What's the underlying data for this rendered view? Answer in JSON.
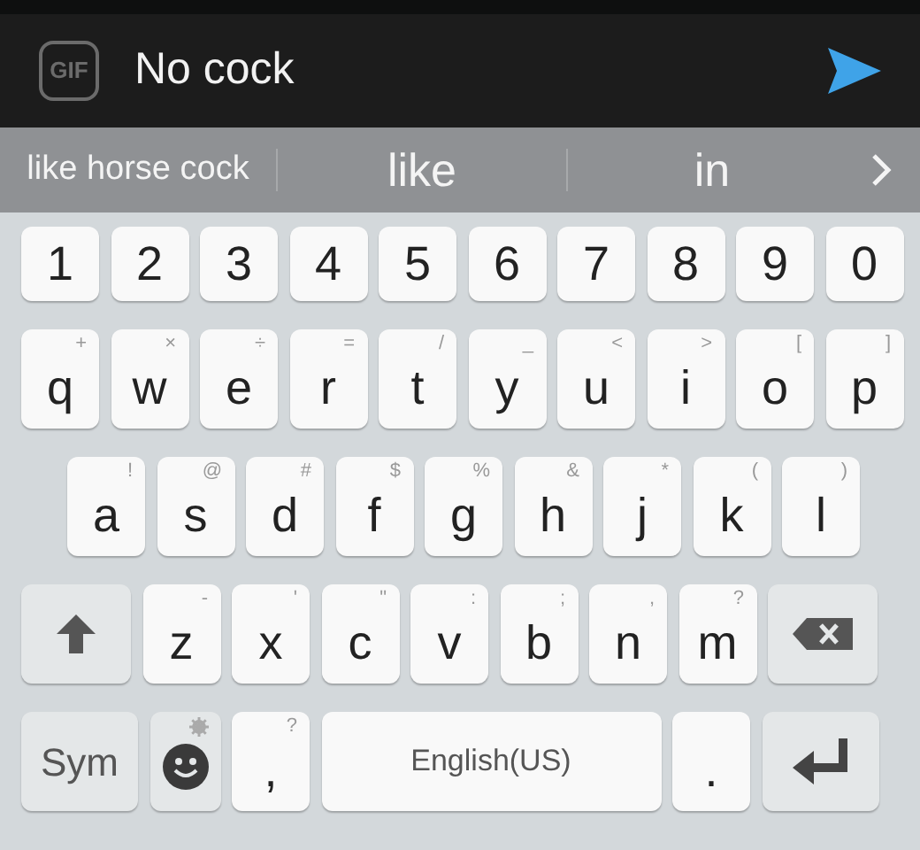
{
  "message_bar": {
    "gif_label": "GIF",
    "text": "No cock"
  },
  "suggestions": [
    {
      "text": "like horse cock",
      "kind": "phrase"
    },
    {
      "text": "like",
      "kind": "word"
    },
    {
      "text": "in",
      "kind": "word"
    }
  ],
  "keyboard": {
    "rows": [
      {
        "keys": [
          {
            "kind": "char",
            "label": "1"
          },
          {
            "kind": "char",
            "label": "2"
          },
          {
            "kind": "char",
            "label": "3"
          },
          {
            "kind": "char",
            "label": "4"
          },
          {
            "kind": "char",
            "label": "5"
          },
          {
            "kind": "char",
            "label": "6"
          },
          {
            "kind": "char",
            "label": "7"
          },
          {
            "kind": "char",
            "label": "8"
          },
          {
            "kind": "char",
            "label": "9"
          },
          {
            "kind": "char",
            "label": "0"
          }
        ]
      },
      {
        "keys": [
          {
            "kind": "char",
            "label": "q",
            "hint": "+"
          },
          {
            "kind": "char",
            "label": "w",
            "hint": "×"
          },
          {
            "kind": "char",
            "label": "e",
            "hint": "÷"
          },
          {
            "kind": "char",
            "label": "r",
            "hint": "="
          },
          {
            "kind": "char",
            "label": "t",
            "hint": "/"
          },
          {
            "kind": "char",
            "label": "y",
            "hint": "_"
          },
          {
            "kind": "char",
            "label": "u",
            "hint": "<"
          },
          {
            "kind": "char",
            "label": "i",
            "hint": ">"
          },
          {
            "kind": "char",
            "label": "o",
            "hint": "["
          },
          {
            "kind": "char",
            "label": "p",
            "hint": "]"
          }
        ]
      },
      {
        "keys": [
          {
            "kind": "char",
            "label": "a",
            "hint": "!"
          },
          {
            "kind": "char",
            "label": "s",
            "hint": "@"
          },
          {
            "kind": "char",
            "label": "d",
            "hint": "#"
          },
          {
            "kind": "char",
            "label": "f",
            "hint": "$"
          },
          {
            "kind": "char",
            "label": "g",
            "hint": "%"
          },
          {
            "kind": "char",
            "label": "h",
            "hint": "&"
          },
          {
            "kind": "char",
            "label": "j",
            "hint": "*"
          },
          {
            "kind": "char",
            "label": "k",
            "hint": "("
          },
          {
            "kind": "char",
            "label": "l",
            "hint": ")"
          }
        ]
      },
      {
        "keys": [
          {
            "kind": "shift"
          },
          {
            "kind": "char",
            "label": "z",
            "hint": "-"
          },
          {
            "kind": "char",
            "label": "x",
            "hint": "'"
          },
          {
            "kind": "char",
            "label": "c",
            "hint": "\""
          },
          {
            "kind": "char",
            "label": "v",
            "hint": ":"
          },
          {
            "kind": "char",
            "label": "b",
            "hint": ";"
          },
          {
            "kind": "char",
            "label": "n",
            "hint": ","
          },
          {
            "kind": "char",
            "label": "m",
            "hint": "?"
          },
          {
            "kind": "backspace"
          }
        ]
      },
      {
        "keys": [
          {
            "kind": "sym",
            "label": "Sym"
          },
          {
            "kind": "emoji"
          },
          {
            "kind": "char",
            "label": ",",
            "hint": "?"
          },
          {
            "kind": "space",
            "label": "English(US)"
          },
          {
            "kind": "char",
            "label": "."
          },
          {
            "kind": "enter"
          }
        ]
      }
    ]
  }
}
